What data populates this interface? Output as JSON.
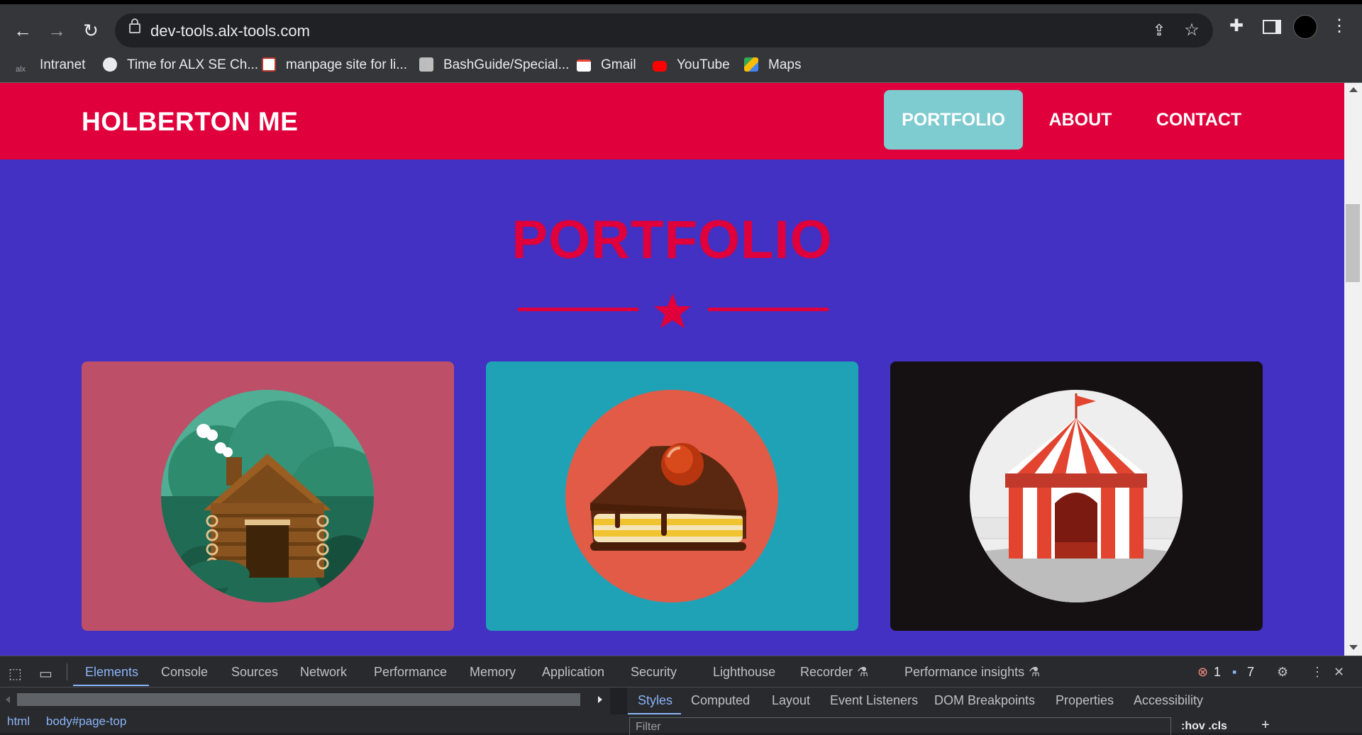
{
  "browser": {
    "url": "dev-tools.alx-tools.com",
    "nav_icons": [
      "back-arrow-icon",
      "forward-arrow-icon",
      "reload-icon"
    ],
    "bookmarks": [
      {
        "label": "Intranet"
      },
      {
        "label": "Time for ALX SE Ch..."
      },
      {
        "label": "manpage site for li..."
      },
      {
        "label": "BashGuide/Special..."
      },
      {
        "label": "Gmail"
      },
      {
        "label": "YouTube"
      },
      {
        "label": "Maps"
      }
    ]
  },
  "page": {
    "brand": "HOLBERTON ME",
    "nav": [
      {
        "label": "PORTFOLIO",
        "active": true
      },
      {
        "label": "ABOUT",
        "active": false
      },
      {
        "label": "CONTACT",
        "active": false
      }
    ],
    "section_title": "PORTFOLIO",
    "cards": [
      {
        "illustration": "log-cabin",
        "bg": "#bd5068"
      },
      {
        "illustration": "cake-slice",
        "bg": "#1fa2b5"
      },
      {
        "illustration": "circus-tent",
        "bg": "#151011"
      }
    ],
    "colors": {
      "nav_bg": "#e0003b",
      "page_bg": "#4231c2",
      "active_nav": "#7ecbd0"
    }
  },
  "devtools": {
    "tabs": [
      "Elements",
      "Console",
      "Sources",
      "Network",
      "Performance",
      "Memory",
      "Application",
      "Security",
      "Lighthouse",
      "Recorder",
      "Performance insights"
    ],
    "active_tab": "Elements",
    "error_count": "1",
    "message_count": "7",
    "styles_tabs": [
      "Styles",
      "Computed",
      "Layout",
      "Event Listeners",
      "DOM Breakpoints",
      "Properties",
      "Accessibility"
    ],
    "breadcrumbs": [
      "html",
      "body#page-top"
    ],
    "filter_placeholder": "Filter",
    "hov_cls": ":hov  .cls"
  }
}
